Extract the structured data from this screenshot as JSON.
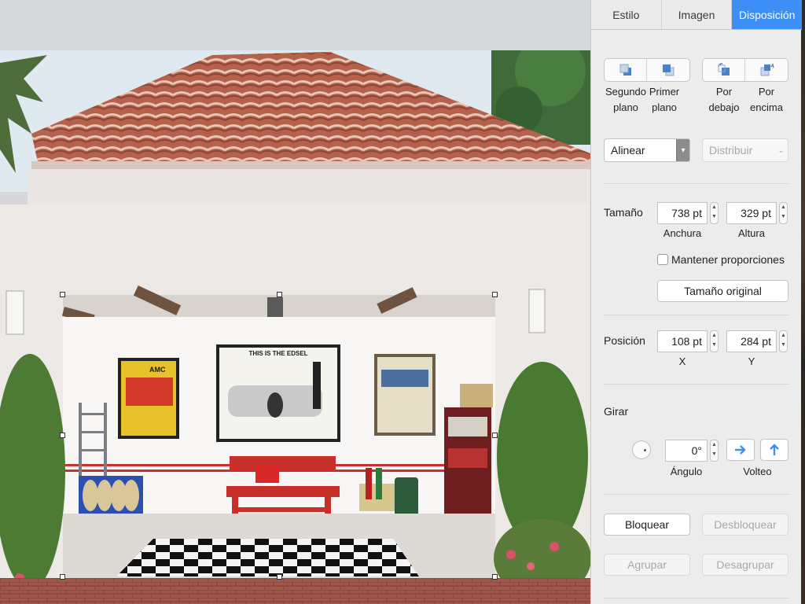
{
  "tabs": [
    {
      "label": "Estilo",
      "active": false
    },
    {
      "label": "Imagen",
      "active": false
    },
    {
      "label": "Disposición",
      "active": true
    }
  ],
  "arrange": {
    "back_label_1": "Segundo",
    "back_label_2": "plano",
    "front_label_1": "Primer",
    "front_label_2": "plano",
    "backward_label_1": "Por",
    "backward_label_2": "debajo",
    "forward_label_1": "Por",
    "forward_label_2": "encima",
    "align": "Alinear",
    "distribute": "Distribuir"
  },
  "size": {
    "section": "Tamaño",
    "width_value": "738 pt",
    "height_value": "329 pt",
    "width_label": "Anchura",
    "height_label": "Altura",
    "constrain_label": "Mantener proporciones",
    "constrain_checked": false,
    "original_size": "Tamaño original"
  },
  "position": {
    "section": "Posición",
    "x_value": "108 pt",
    "y_value": "284 pt",
    "x_label": "X",
    "y_label": "Y"
  },
  "rotate": {
    "section": "Girar",
    "angle_value": "0°",
    "angle_label": "Ángulo",
    "flip_label": "Volteo"
  },
  "lock": {
    "lock_label": "Bloquear",
    "unlock_label": "Desbloquear",
    "group_label": "Agrupar",
    "ungroup_label": "Desagrupar"
  },
  "image": {
    "poster_left_text": "AMC",
    "poster_center_text": "THIS IS THE EDSEL",
    "accent": "#3e8ff5"
  }
}
